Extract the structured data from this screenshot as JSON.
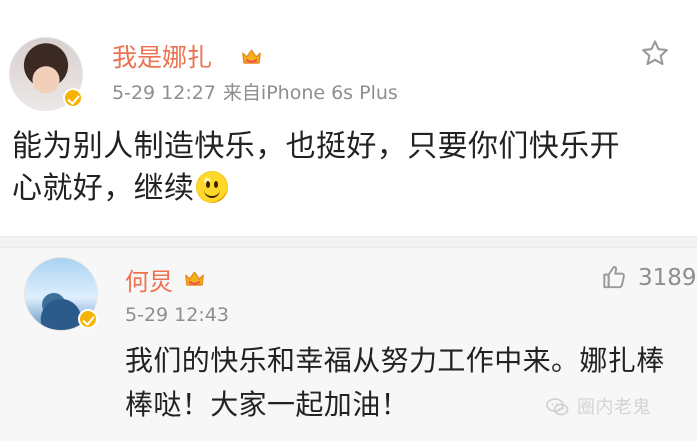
{
  "top_post": {
    "username": "我是娜扎",
    "time": "5-29 12:27",
    "source": "来自iPhone 6s Plus",
    "text_lines": [
      "能为别人制造快乐，也挺好，只要你们快乐开",
      "心就好，继续"
    ],
    "icons": {
      "avatar": "avatar",
      "verified": "verified-badge-icon",
      "vip": "vip-crown-icon",
      "favorite": "star-icon",
      "emoji": "smile-emoji-icon"
    }
  },
  "comment": {
    "username": "何炅",
    "time": "5-29 12:43",
    "like_count": "3189",
    "text_lines": [
      "我们的快乐和幸福从努力工作中来。娜扎棒",
      "棒哒！大家一起加油！"
    ],
    "icons": {
      "avatar": "avatar",
      "verified": "verified-badge-icon",
      "vip": "vip-crown-icon",
      "like": "thumb-up-icon"
    }
  },
  "watermark": {
    "text": "圈内老鬼",
    "icon": "wechat-watermark-icon"
  },
  "colors": {
    "name": "#eb7350",
    "meta": "#8e8e8e",
    "text": "#222222",
    "separator": "#f2f2f2",
    "comment_background": "#f7f7f7",
    "verified": "#f6b300"
  }
}
